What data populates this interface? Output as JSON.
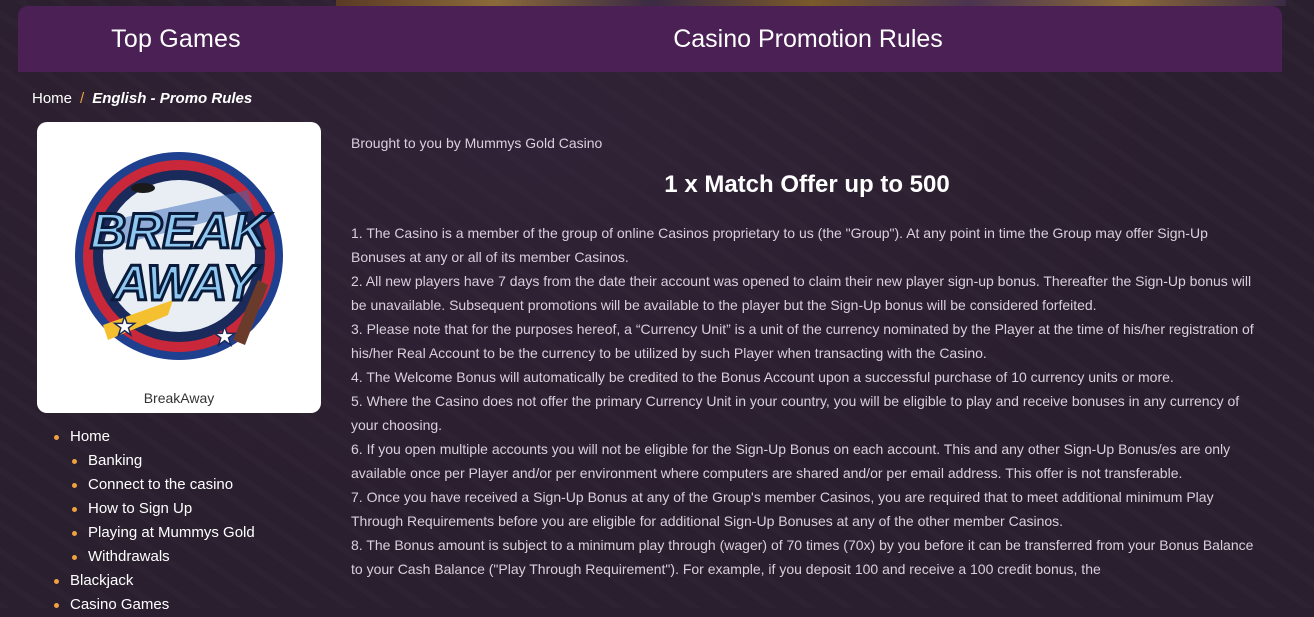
{
  "header": {
    "left_title": "Top Games",
    "right_title": "Casino Promotion Rules"
  },
  "breadcrumb": {
    "home": "Home",
    "separator": "/",
    "current": "English - Promo Rules"
  },
  "game_card": {
    "logo_line1": "BREAK",
    "logo_line2": "AWAY",
    "name": "BreakAway"
  },
  "nav": {
    "items": [
      {
        "label": "Home",
        "level": 1
      },
      {
        "label": "Banking",
        "level": 2
      },
      {
        "label": "Connect to the casino",
        "level": 2
      },
      {
        "label": "How to Sign Up",
        "level": 2
      },
      {
        "label": "Playing at Mummys Gold",
        "level": 2
      },
      {
        "label": "Withdrawals",
        "level": 2
      },
      {
        "label": "Blackjack",
        "level": 1
      },
      {
        "label": "Casino Games",
        "level": 1
      }
    ]
  },
  "content": {
    "intro": "Brought to you by Mummys Gold Casino",
    "offer_title": "1 x Match Offer up to 500",
    "rules": [
      "1. The Casino is a member of the group of online Casinos proprietary to us (the \"Group\"). At any point in time the Group may offer Sign-Up Bonuses at any or all of its member Casinos.",
      "2. All new players have 7 days from the date their account was opened to claim their new player sign-up bonus. Thereafter the Sign-Up bonus will be unavailable. Subsequent promotions will be available to the player but the Sign-Up bonus will be considered forfeited.",
      "3. Please note that for the purposes hereof, a “Currency Unit” is a unit of the currency nominated by the Player at the time of his/her registration of his/her Real Account to be the currency to be utilized by such Player when transacting with the Casino.",
      "4. The Welcome Bonus will automatically be credited to the Bonus Account upon a successful purchase of 10 currency units or more.",
      "5. Where the Casino does not offer the primary Currency Unit in your country, you will be eligible to play and receive bonuses in any currency of your choosing.",
      "6. If you open multiple accounts you will not be eligible for the Sign-Up Bonus on each account. This and any other Sign-Up Bonus/es are only available once per Player and/or per environment where computers are shared and/or per email address. This offer is not transferable.",
      "7. Once you have received a Sign-Up Bonus at any of the Group's member Casinos, you are required that to meet additional minimum Play Through Requirements before you are eligible for additional Sign-Up Bonuses at any of the other member Casinos.",
      "8. The Bonus amount is subject to a minimum play through (wager) of 70 times (70x) by you before it can be transferred from your Bonus Balance to your Cash Balance (\"Play Through Requirement\"). For example, if you deposit 100 and receive a 100 credit bonus, the"
    ]
  },
  "colors": {
    "header_bg": "#4a2055",
    "page_bg": "#2a1f2e",
    "accent": "#f0a040"
  }
}
